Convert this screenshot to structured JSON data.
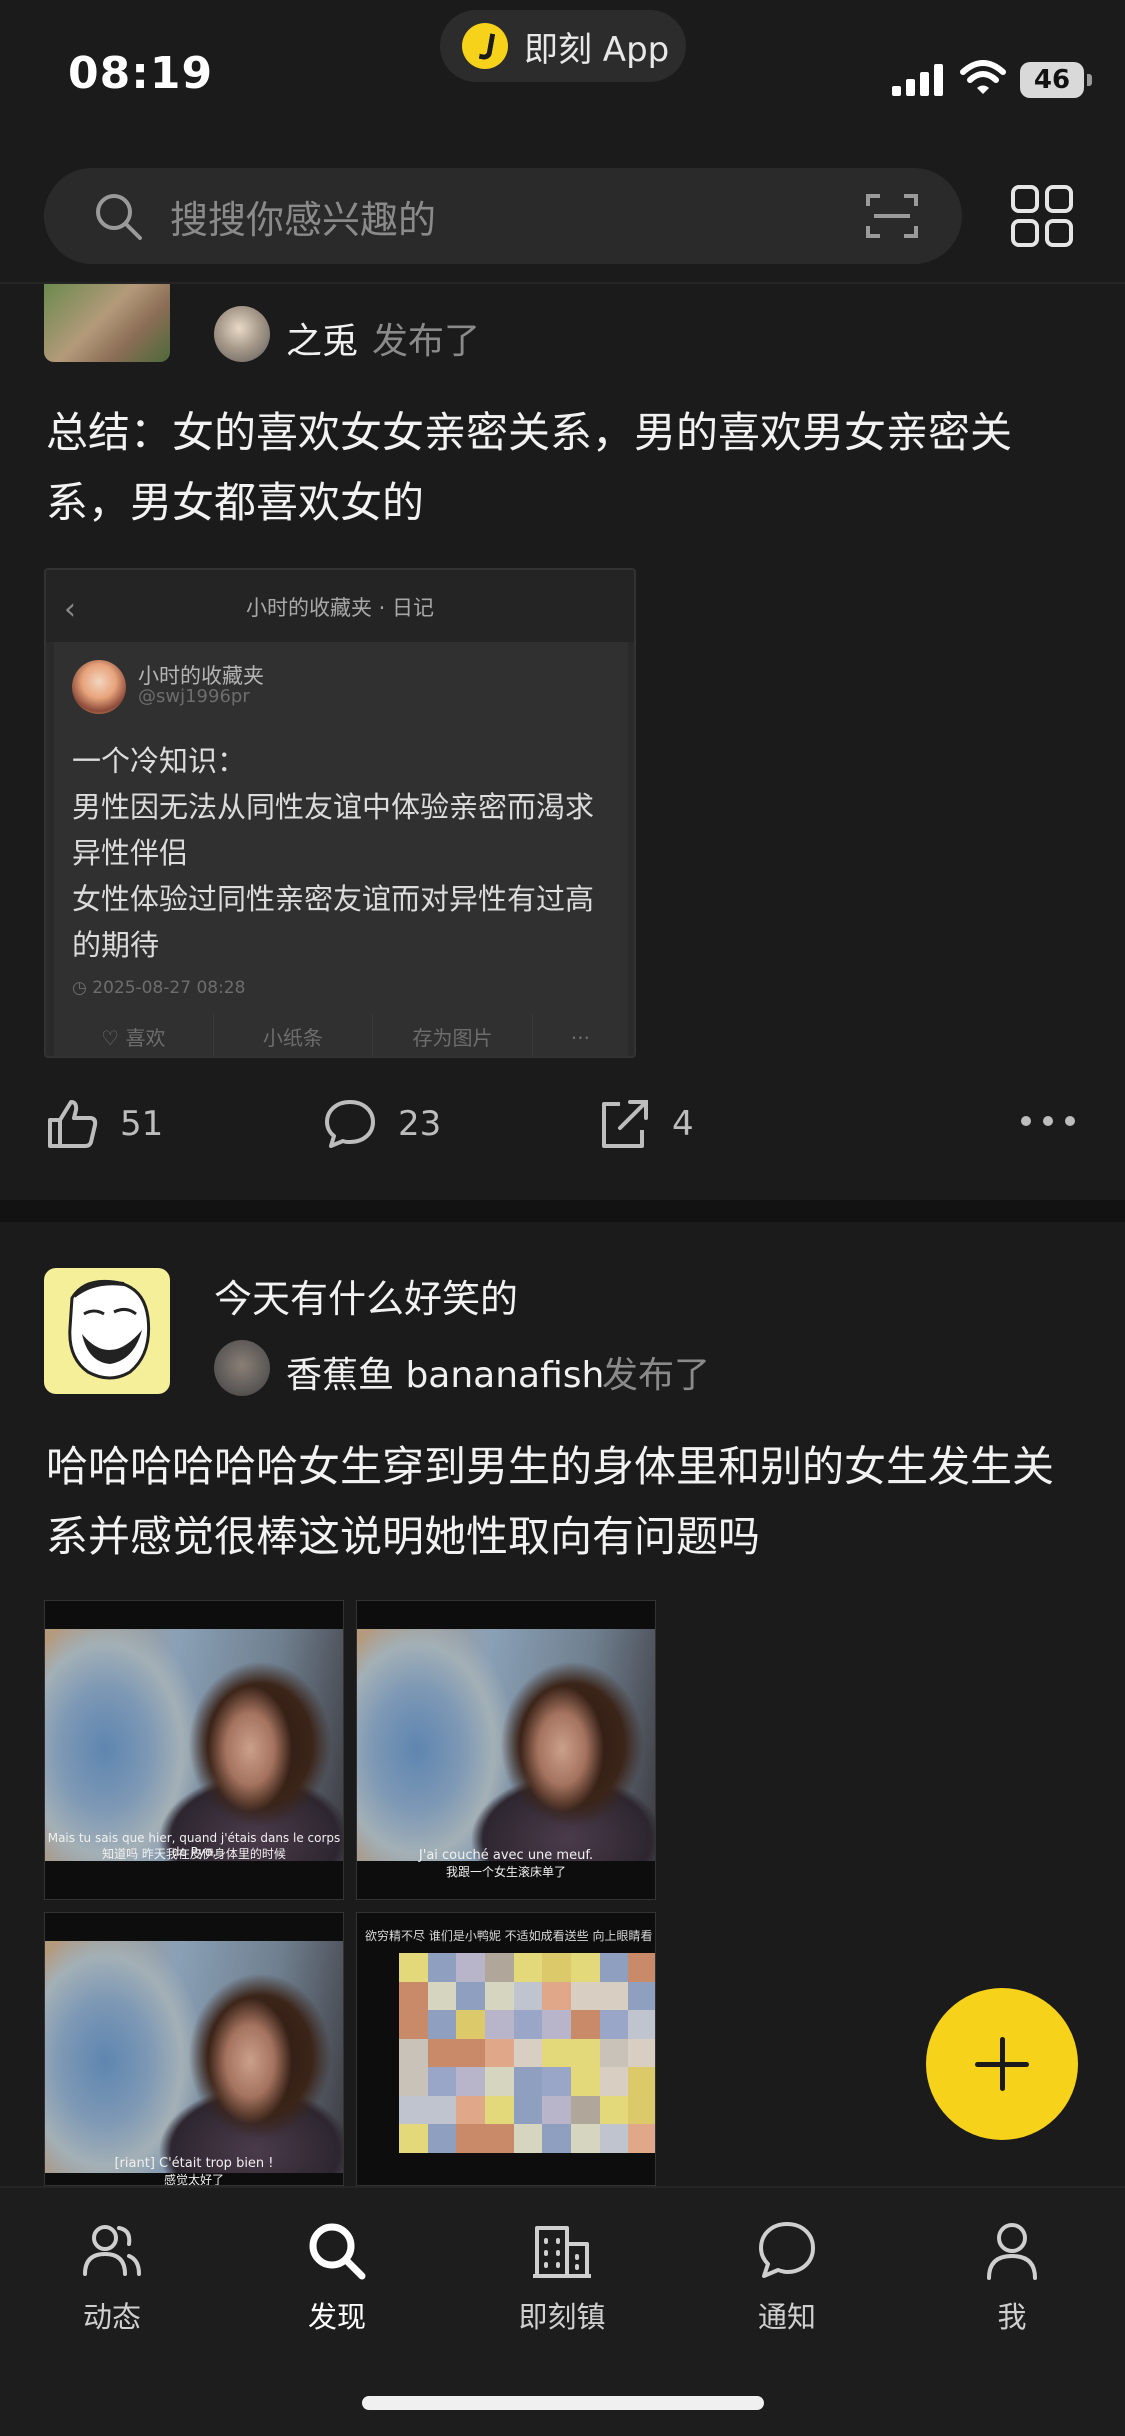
{
  "status_bar": {
    "time": "08:19",
    "app_pill": "即刻 App",
    "battery": "46"
  },
  "search": {
    "placeholder": "搜搜你感兴趣的"
  },
  "post1": {
    "author": "之兎",
    "published": "发布了",
    "text": "总结：女的喜欢女女亲密关系，男的喜欢男女亲密关系，男女都喜欢女的",
    "screenshot": {
      "back": "‹",
      "title": "小时的收藏夹 · 日记",
      "name": "小时的收藏夹",
      "handle": "@swj1996pr",
      "lines": [
        "一个冷知识：",
        "男性因无法从同性友谊中体验亲密而渴求异性伴侣",
        "女性体验过同性亲密友谊而对异性有过高的期待"
      ],
      "date": "2025-08-27 08:28",
      "actions": [
        "♡ 喜欢",
        "小纸条",
        "存为图片",
        "···"
      ]
    },
    "likes": "51",
    "comments": "23",
    "shares": "4"
  },
  "post2": {
    "topic": "今天有什么好笑的",
    "author": "香蕉鱼 bananafish",
    "published": "发布了",
    "text": "哈哈哈哈哈哈女生穿到男生的身体里和别的女生发生关系并感觉很棒这说明她性取向有问题吗",
    "images": [
      {
        "sub1": "Mais tu sais que hier, quand j'étais dans le corps de Pyo,",
        "sub2": "知道吗 昨天我在皮伊身体里的时候"
      },
      {
        "sub1": "J'ai couché avec une meuf.",
        "sub2": "我跟一个女生滚床单了"
      },
      {
        "sub1": "[riant] C'était trop bien !",
        "sub2": "感觉太好了"
      },
      {
        "caption": "欲穷精不尽 谁们是小鸭妮 不适如成看送些 向上眼睛看"
      }
    ]
  },
  "tabs": [
    {
      "label": "动态",
      "icon": "users-icon"
    },
    {
      "label": "发现",
      "icon": "search-icon"
    },
    {
      "label": "即刻镇",
      "icon": "building-icon"
    },
    {
      "label": "通知",
      "icon": "chat-bubble-icon"
    },
    {
      "label": "我",
      "icon": "person-icon"
    }
  ],
  "colors": {
    "accent": "#f7d21a",
    "background": "#1b1b1b"
  }
}
